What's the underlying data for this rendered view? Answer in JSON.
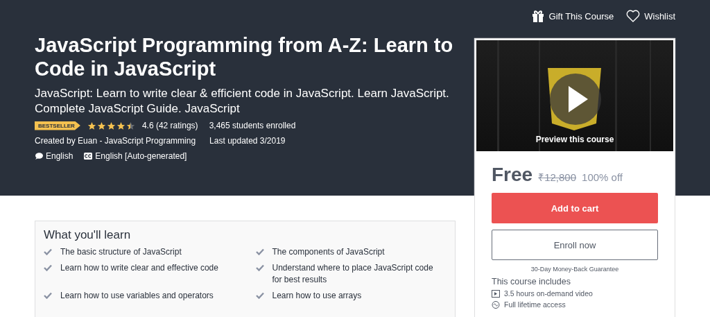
{
  "top_actions": [
    {
      "kind": "gift",
      "label": "Gift This Course"
    },
    {
      "kind": "wishlist",
      "label": "Wishlist"
    }
  ],
  "course": {
    "title": "JavaScript Programming from A-Z: Learn to Code in JavaScript",
    "subtitle": "JavaScript: Learn to write clear & efficient code in JavaScript. Learn JavaScript. Complete JavaScript Guide. JavaScript",
    "badge": "BESTSELLER",
    "stars": 4.5,
    "rating": "4.6 (42 ratings)",
    "enrolled": "3,465 students enrolled",
    "created_by": "Created by Euan - JavaScript Programming",
    "last_updated": "Last updated 3/2019",
    "language": "English",
    "captions": "English [Auto-generated]"
  },
  "learn": {
    "heading": "What you'll learn",
    "items": [
      "The basic structure of JavaScript",
      "The components of JavaScript",
      "Learn how to write clear and effective code",
      "Understand where to place JavaScript code for best results",
      "Learn how to use variables and operators",
      "Learn how to use arrays"
    ]
  },
  "purchase": {
    "preview": "Preview this course",
    "price": "Free",
    "original_price": "₹12,800",
    "discount": "100% off",
    "add_to_cart": "Add to cart",
    "enroll": "Enroll now",
    "guarantee": "30-Day Money-Back Guarantee",
    "includes_heading": "This course includes",
    "includes": [
      {
        "kind": "video",
        "label": "3.5 hours on-demand video"
      },
      {
        "kind": "lifetime",
        "label": "Full lifetime access"
      }
    ]
  }
}
